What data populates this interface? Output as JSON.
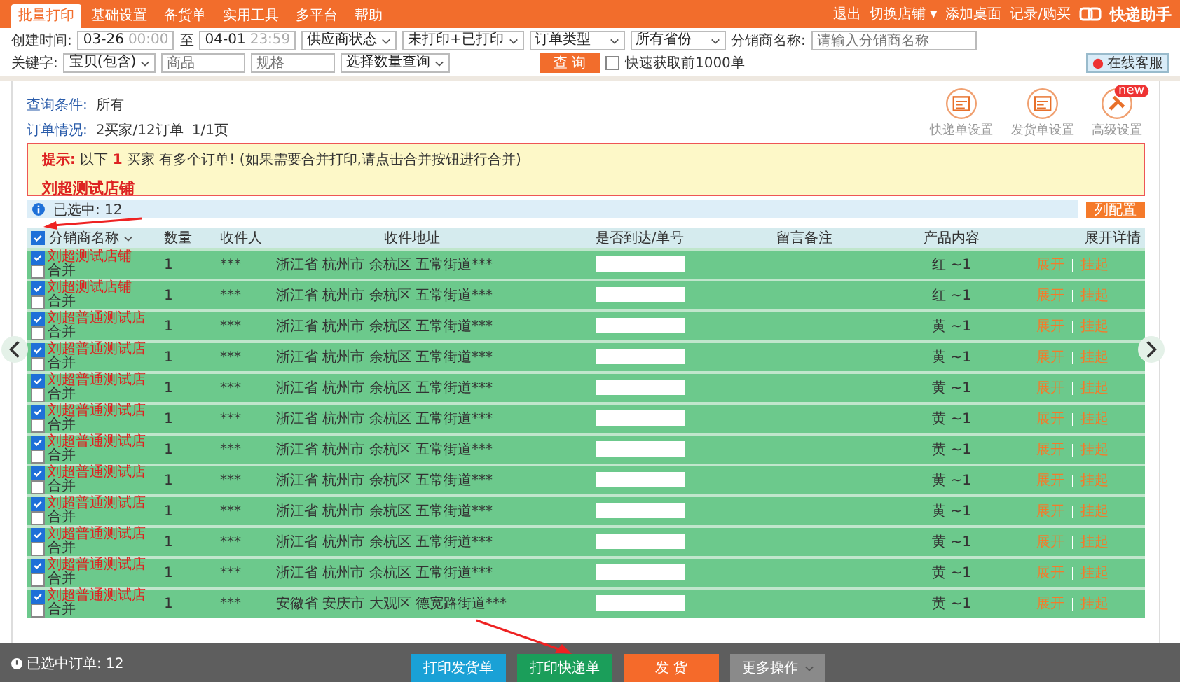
{
  "nav": {
    "tabs": [
      {
        "label": "批量打印",
        "selected": true
      },
      {
        "label": "基础设置",
        "selected": false
      },
      {
        "label": "备货单",
        "selected": false
      },
      {
        "label": "实用工具",
        "selected": false
      },
      {
        "label": "多平台",
        "selected": false
      },
      {
        "label": "帮助",
        "selected": false
      }
    ],
    "links": [
      "退出",
      "切换店铺 ▾",
      "添加桌面",
      "记录/购买"
    ],
    "logo": "快递助手"
  },
  "filters": {
    "created_label": "创建时间:",
    "start_date": "03-26",
    "start_time": "00:00",
    "to": "至",
    "end_date": "04-01",
    "end_time": "23:59",
    "selects1": [
      "供应商状态",
      "未打印+已打印",
      "订单类型",
      "所有省份"
    ],
    "distributor_label": "分销商名称:",
    "distributor_placeholder": "请输入分销商名称",
    "keyword_label": "关键字:",
    "keyword_select": "宝贝(包含)",
    "goods_placeholder": "商品",
    "spec_placeholder": "规格",
    "qty_select": "选择数量查询",
    "search_button": "查 询",
    "fast_fetch": {
      "label": "快速获取前1000单",
      "checked": false
    },
    "service_button": "在线客服"
  },
  "summary": {
    "cond_label": "查询条件:",
    "cond_value": "所有",
    "orders_label": "订单情况:",
    "orders_value": "2买家/12订单",
    "page": "1/1页"
  },
  "tools": [
    {
      "label": "快递单设置"
    },
    {
      "label": "发货单设置"
    },
    {
      "label": "高级设置",
      "badge": "new"
    }
  ],
  "notice": {
    "text": "**提示:** 以下 **1** 买家 有多个订单! (如果需要合并打印,请点击合并按钮进行合并)",
    "shop": "刘超测试店铺"
  },
  "selection": {
    "text": "已选中: 12",
    "column_button": "列配置"
  },
  "table": {
    "all_checked": true,
    "columns": [
      "分销商名称",
      "数量",
      "收件人",
      "收件地址",
      "是否到达/单号",
      "留言备注",
      "产品内容",
      "展开详情"
    ],
    "rows": [
      {
        "shop": "刘超测试店铺",
        "checked": true,
        "merge": "合并",
        "merged": false,
        "qty": "1",
        "receiver": "***",
        "address": "浙江省 杭州市 余杭区 五常街道***",
        "product": "红 ~1",
        "expand": "展开",
        "hold": "挂起"
      },
      {
        "shop": "刘超测试店铺",
        "checked": true,
        "merge": "合并",
        "merged": false,
        "qty": "1",
        "receiver": "***",
        "address": "浙江省 杭州市 余杭区 五常街道***",
        "product": "红 ~1",
        "expand": "展开",
        "hold": "挂起"
      },
      {
        "shop": "刘超普通测试店",
        "checked": true,
        "merge": "合并",
        "merged": false,
        "qty": "1",
        "receiver": "***",
        "address": "浙江省 杭州市 余杭区 五常街道***",
        "product": "黄 ~1",
        "expand": "展开",
        "hold": "挂起"
      },
      {
        "shop": "刘超普通测试店",
        "checked": true,
        "merge": "合并",
        "merged": false,
        "qty": "1",
        "receiver": "***",
        "address": "浙江省 杭州市 余杭区 五常街道***",
        "product": "黄 ~1",
        "expand": "展开",
        "hold": "挂起"
      },
      {
        "shop": "刘超普通测试店",
        "checked": true,
        "merge": "合并",
        "merged": false,
        "qty": "1",
        "receiver": "***",
        "address": "浙江省 杭州市 余杭区 五常街道***",
        "product": "黄 ~1",
        "expand": "展开",
        "hold": "挂起"
      },
      {
        "shop": "刘超普通测试店",
        "checked": true,
        "merge": "合并",
        "merged": false,
        "qty": "1",
        "receiver": "***",
        "address": "浙江省 杭州市 余杭区 五常街道***",
        "product": "黄 ~1",
        "expand": "展开",
        "hold": "挂起"
      },
      {
        "shop": "刘超普通测试店",
        "checked": true,
        "merge": "合并",
        "merged": false,
        "qty": "1",
        "receiver": "***",
        "address": "浙江省 杭州市 余杭区 五常街道***",
        "product": "黄 ~1",
        "expand": "展开",
        "hold": "挂起"
      },
      {
        "shop": "刘超普通测试店",
        "checked": true,
        "merge": "合并",
        "merged": false,
        "qty": "1",
        "receiver": "***",
        "address": "浙江省 杭州市 余杭区 五常街道***",
        "product": "黄 ~1",
        "expand": "展开",
        "hold": "挂起"
      },
      {
        "shop": "刘超普通测试店",
        "checked": true,
        "merge": "合并",
        "merged": false,
        "qty": "1",
        "receiver": "***",
        "address": "浙江省 杭州市 余杭区 五常街道***",
        "product": "黄 ~1",
        "expand": "展开",
        "hold": "挂起"
      },
      {
        "shop": "刘超普通测试店",
        "checked": true,
        "merge": "合并",
        "merged": false,
        "qty": "1",
        "receiver": "***",
        "address": "浙江省 杭州市 余杭区 五常街道***",
        "product": "黄 ~1",
        "expand": "展开",
        "hold": "挂起"
      },
      {
        "shop": "刘超普通测试店",
        "checked": true,
        "merge": "合并",
        "merged": false,
        "qty": "1",
        "receiver": "***",
        "address": "浙江省 杭州市 余杭区 五常街道***",
        "product": "黄 ~1",
        "expand": "展开",
        "hold": "挂起"
      },
      {
        "shop": "刘超普通测试店",
        "checked": true,
        "merge": "合并",
        "merged": false,
        "qty": "1",
        "receiver": "***",
        "address": "安徽省 安庆市 大观区 德宽路街道***",
        "product": "黄 ~1",
        "expand": "展开",
        "hold": "挂起"
      }
    ]
  },
  "footer": {
    "selected_text": "已选中订单: 12",
    "buttons": [
      {
        "label": "打印发货单",
        "kind": "blue"
      },
      {
        "label": "打印快递单",
        "kind": "green"
      },
      {
        "label": "发 货",
        "kind": "orange"
      },
      {
        "label": "更多操作",
        "kind": "grey"
      }
    ]
  }
}
